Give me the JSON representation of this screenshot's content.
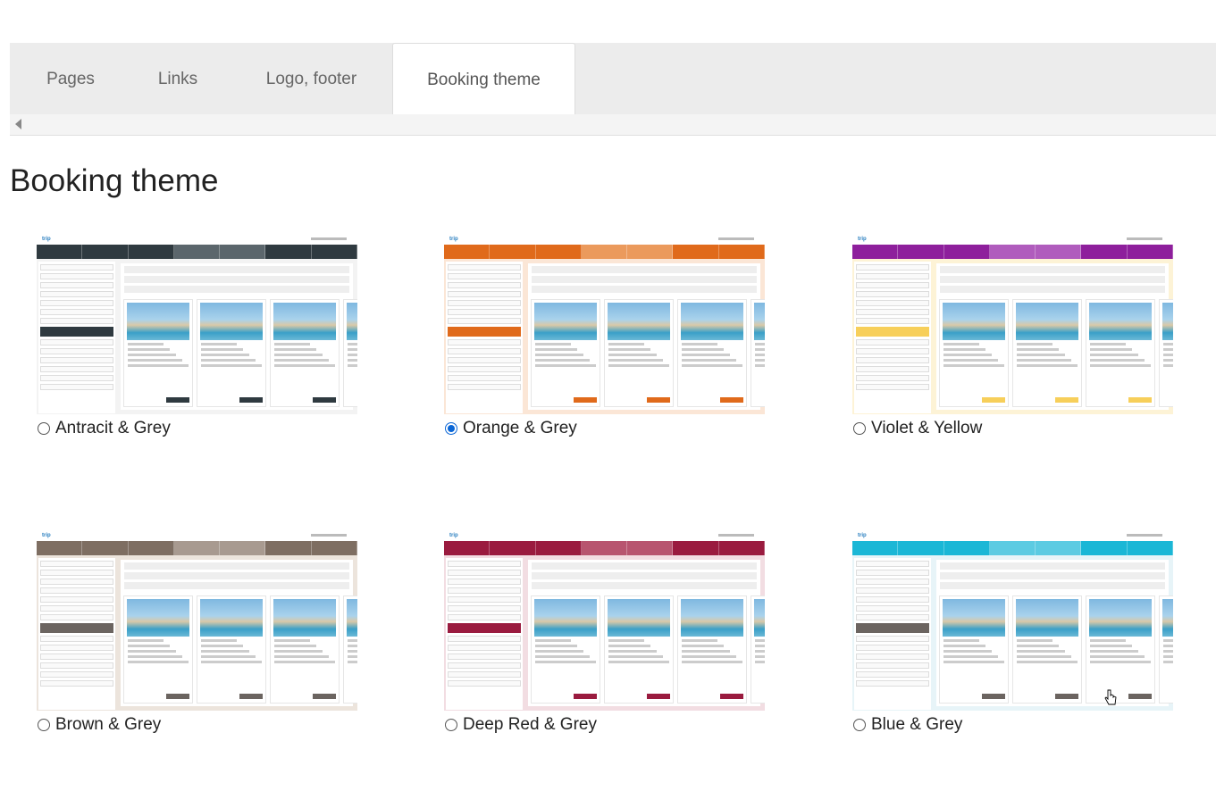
{
  "tabs": [
    {
      "label": "Pages"
    },
    {
      "label": "Links"
    },
    {
      "label": "Logo, footer"
    },
    {
      "label": "Booking theme",
      "active": true
    }
  ],
  "page_title": "Booking theme",
  "themes": [
    {
      "label": "Antracit & Grey",
      "selected": false,
      "nav": [
        "#2f3a40",
        "#2f3a40",
        "#2f3a40",
        "#5b666c",
        "#5b666c",
        "#2f3a40",
        "#2f3a40"
      ],
      "accent": "#2f3a40",
      "bg": "#f3f3f3"
    },
    {
      "label": "Orange & Grey",
      "selected": true,
      "nav": [
        "#e06a1b",
        "#e06a1b",
        "#e06a1b",
        "#eb9a5c",
        "#eb9a5c",
        "#e06a1b",
        "#e06a1b"
      ],
      "accent": "#e06a1b",
      "bg": "#fbe6d6"
    },
    {
      "label": "Violet & Yellow",
      "selected": false,
      "nav": [
        "#8e1f9c",
        "#8e1f9c",
        "#8e1f9c",
        "#b05cbd",
        "#b05cbd",
        "#8e1f9c",
        "#8e1f9c"
      ],
      "accent": "#f7cf5a",
      "bg": "#fdf3d6"
    },
    {
      "label": "Brown & Grey",
      "selected": false,
      "nav": [
        "#7e6e62",
        "#7e6e62",
        "#7e6e62",
        "#a89a90",
        "#a89a90",
        "#7e6e62",
        "#7e6e62"
      ],
      "accent": "#6b6460",
      "bg": "#ece4dc"
    },
    {
      "label": "Deep Red & Grey",
      "selected": false,
      "nav": [
        "#9a1b3f",
        "#9a1b3f",
        "#9a1b3f",
        "#b8546f",
        "#b8546f",
        "#9a1b3f",
        "#9a1b3f"
      ],
      "accent": "#9a1b3f",
      "bg": "#f2dde2"
    },
    {
      "label": "Blue & Grey",
      "selected": false,
      "nav": [
        "#1bb7d6",
        "#1bb7d6",
        "#1bb7d6",
        "#5ccbe2",
        "#5ccbe2",
        "#1bb7d6",
        "#1bb7d6"
      ],
      "accent": "#6b6460",
      "bg": "#e7f4f8"
    }
  ],
  "preview_logo": "trip"
}
